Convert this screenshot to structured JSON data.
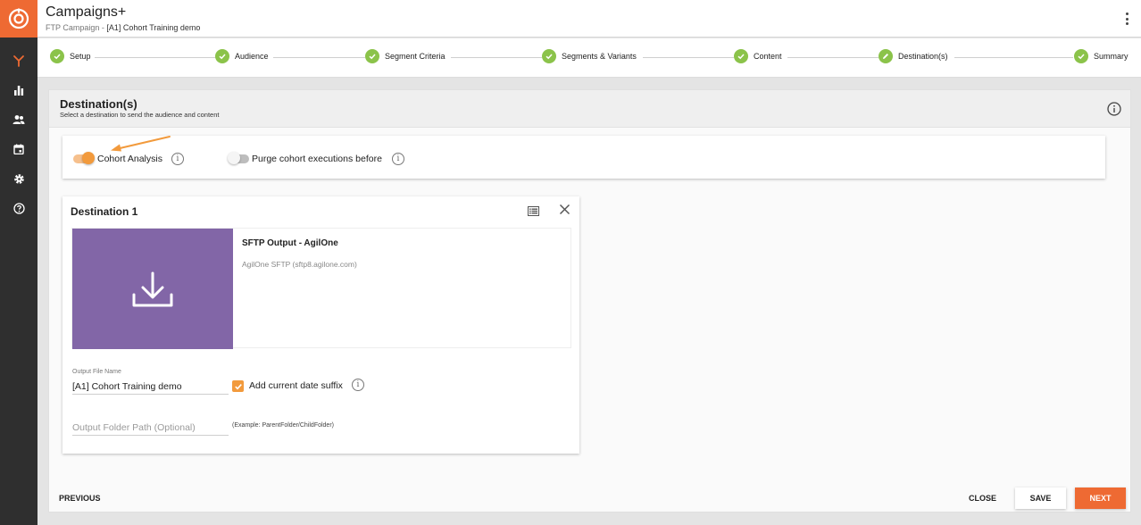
{
  "app": {
    "title": "Campaigns+",
    "subtitle_prefix": "FTP Campaign - ",
    "subtitle_name": "[A1] Cohort Training demo"
  },
  "colors": {
    "brand": "#ee6a33",
    "step_done": "#8bc34a",
    "toggle_on": "#f29a3c",
    "tile_bg": "#8266a7"
  },
  "sidebar": {
    "items": [
      {
        "name": "campaigns-icon",
        "active": true
      },
      {
        "name": "bar-chart-icon"
      },
      {
        "name": "people-icon"
      },
      {
        "name": "calendar-icon"
      },
      {
        "name": "gear-icon"
      },
      {
        "name": "help-icon"
      }
    ]
  },
  "stepper": {
    "steps": [
      {
        "label": "Setup",
        "status": "done"
      },
      {
        "label": "Audience",
        "status": "done"
      },
      {
        "label": "Segment Criteria",
        "status": "done"
      },
      {
        "label": "Segments & Variants",
        "status": "done"
      },
      {
        "label": "Content",
        "status": "done"
      },
      {
        "label": "Destination(s)",
        "status": "editing"
      },
      {
        "label": "Summary",
        "status": "done"
      }
    ]
  },
  "panel": {
    "title": "Destination(s)",
    "subtitle": "Select a destination to send the audience and content"
  },
  "options": {
    "cohort_label": "Cohort Analysis",
    "cohort_on": true,
    "purge_label": "Purge cohort executions before",
    "purge_on": false
  },
  "destination": {
    "title": "Destination 1",
    "tile_name": "SFTP Output - AgilOne",
    "tile_desc": "AgilOne SFTP (sftp8.agilone.com)",
    "file_name_label": "Output File Name",
    "file_name_value": "[A1] Cohort Training demo",
    "date_suffix_label": "Add current date suffix",
    "date_suffix_checked": true,
    "folder_placeholder": "Output Folder Path (Optional)",
    "folder_example": "(Example: ParentFolder/ChildFolder)"
  },
  "footer": {
    "previous": "PREVIOUS",
    "close": "CLOSE",
    "save": "SAVE",
    "next": "NEXT"
  }
}
